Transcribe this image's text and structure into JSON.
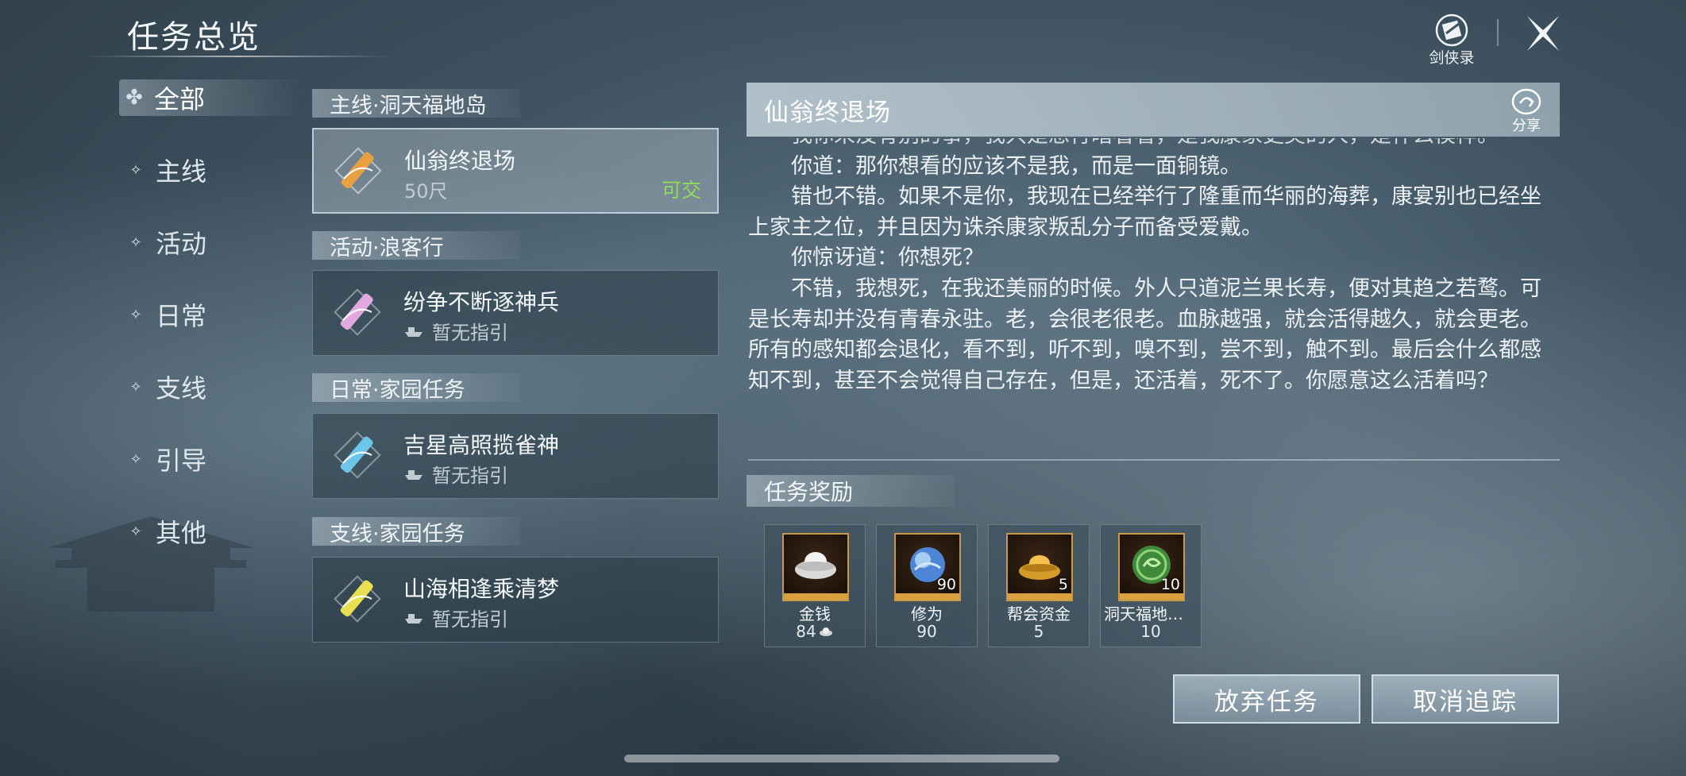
{
  "header": {
    "title": "任务总览",
    "codex_label": "剑侠录"
  },
  "categories": [
    "全部",
    "主线",
    "活动",
    "日常",
    "支线",
    "引导",
    "其他"
  ],
  "groups": [
    {
      "title": "主线·洞天福地岛",
      "quest": {
        "name": "仙翁终退场",
        "sub": "50尺",
        "state": "可交",
        "icon_color": "#e8a040"
      }
    },
    {
      "title": "活动·浪客行",
      "quest": {
        "name": "纷争不断逐神兵",
        "sub": "暂无指引",
        "state": "",
        "icon_color": "#e2a8e0"
      }
    },
    {
      "title": "日常·家园任务",
      "quest": {
        "name": "吉星高照揽雀神",
        "sub": "暂无指引",
        "state": "",
        "icon_color": "#6cc6e8"
      }
    },
    {
      "title": "支线·家园任务",
      "quest": {
        "name": "山海相逢乘清梦",
        "sub": "暂无指引",
        "state": "",
        "icon_color": "#e8e050"
      }
    }
  ],
  "detail": {
    "title": "仙翁终退场",
    "share_label": "分享",
    "story_cut": "我你来没有别的事，我只是想行暗看看，是我康家更美的人，是什么模样。",
    "story": [
      "你道：那你想看的应该不是我，而是一面铜镜。",
      "错也不错。如果不是你，我现在已经举行了隆重而华丽的海葬，康宴别也已经坐上家主之位，并且因为诛杀康家叛乱分子而备受爱戴。",
      "你惊讶道：你想死？",
      "不错，我想死，在我还美丽的时候。外人只道泥兰果长寿，便对其趋之若鹜。可是长寿却并没有青春永驻。老，会很老很老。血脉越强，就会活得越久，就会更老。所有的感知都会退化，看不到，听不到，嗅不到，尝不到，触不到。最后会什么都感知不到，甚至不会觉得自己存在，但是，还活着，死不了。你愿意这么活着吗？"
    ]
  },
  "rewards": {
    "title": "任务奖励",
    "items": [
      {
        "name": "金钱",
        "count": "",
        "amount": "84",
        "icon": "silver-ingot-icon"
      },
      {
        "name": "修为",
        "count": "90",
        "amount": "90",
        "icon": "blue-orb-icon"
      },
      {
        "name": "帮会资金",
        "count": "5",
        "amount": "5",
        "icon": "gold-ingot-icon"
      },
      {
        "name": "洞天福地康...",
        "count": "10",
        "amount": "10",
        "icon": "jade-token-icon"
      }
    ]
  },
  "actions": {
    "abandon": "放弃任务",
    "untrack": "取消追踪"
  }
}
